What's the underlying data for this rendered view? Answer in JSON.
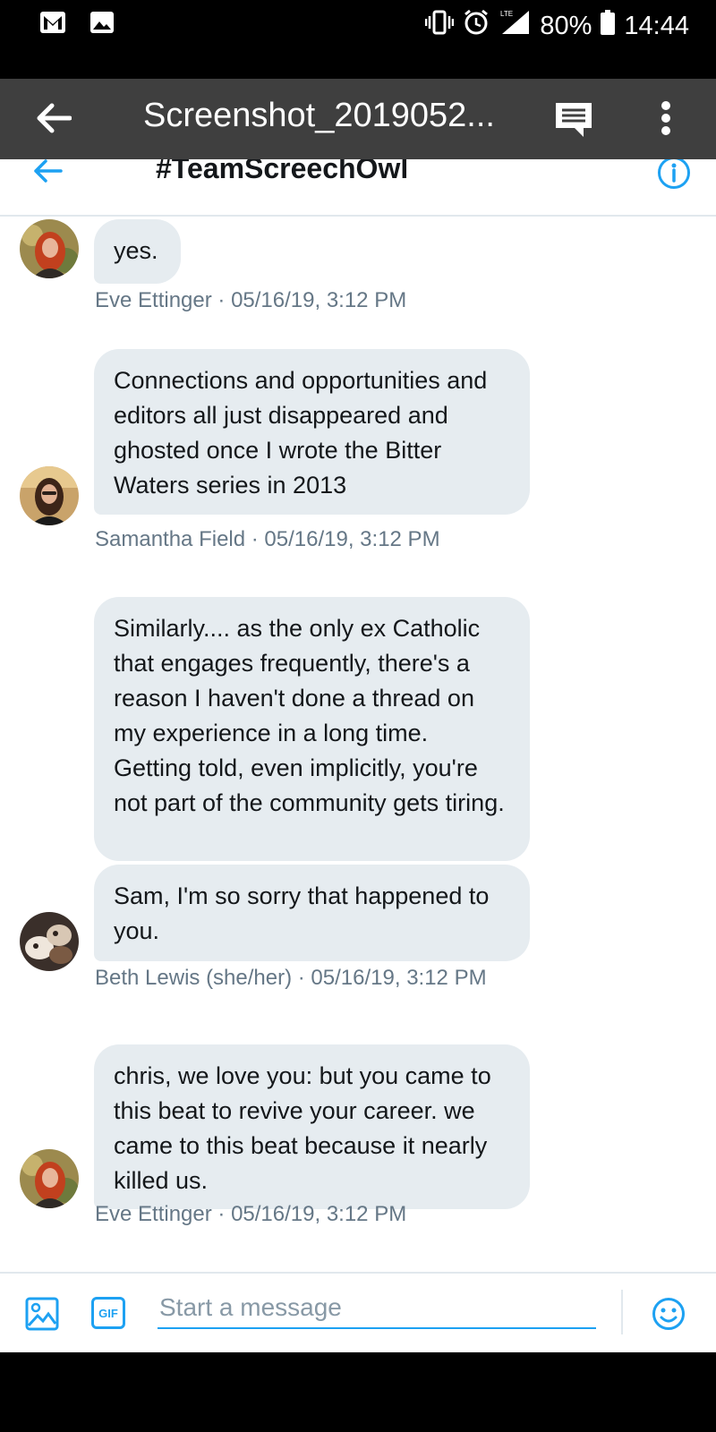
{
  "status_bar": {
    "battery": "80%",
    "time": "14:44",
    "network": "LTE"
  },
  "viewer": {
    "title": "Screenshot_2019052..."
  },
  "conversation": {
    "title": "#TeamScreechOwl"
  },
  "messages": [
    {
      "text": "yes.",
      "meta": "Eve Ettinger · 05/16/19, 3:12 PM"
    },
    {
      "text": "Connections and opportunities and editors all just disappeared and ghosted once I wrote the Bitter Waters series in 2013",
      "meta": "Samantha Field · 05/16/19, 3:12 PM"
    },
    {
      "text": "Similarly.... as the only ex Catholic that engages frequently, there's a reason I haven't done a thread on my experience in a long time. Getting told, even implicitly, you're not part of the community gets tiring."
    },
    {
      "text": "Sam, I'm so sorry that happened to you.",
      "meta": "Beth Lewis (she/her) · 05/16/19, 3:12 PM"
    },
    {
      "text": "chris, we love you: but you came to this beat to revive your career. we came to this beat because it nearly killed us.",
      "meta": "Eve Ettinger · 05/16/19, 3:12 PM"
    }
  ],
  "composer": {
    "placeholder": "Start a message",
    "gif_label": "GIF"
  },
  "colors": {
    "accent": "#1da1f2",
    "bubble": "#e6ecf0",
    "meta_text": "#657786"
  }
}
